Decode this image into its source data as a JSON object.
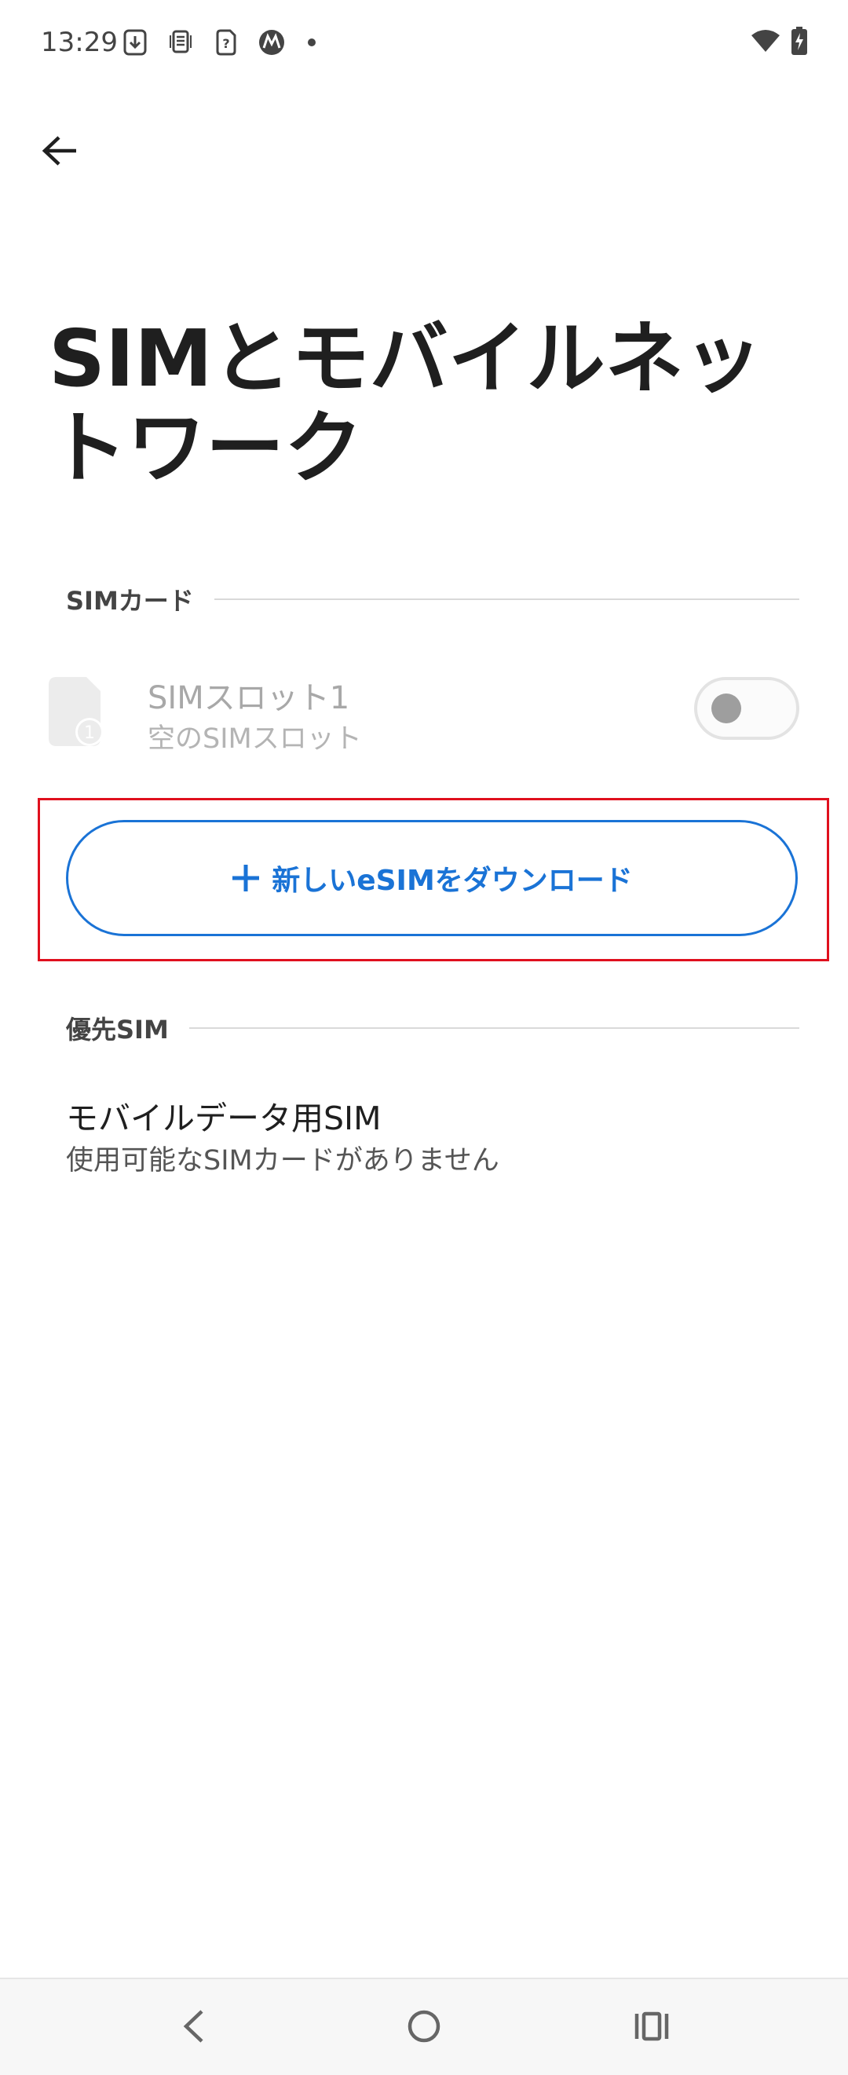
{
  "status_bar": {
    "time": "13:29",
    "left_icons": [
      "download-box-icon",
      "sim-activity-icon",
      "sim-unknown-icon",
      "motorola-logo-icon"
    ],
    "right_icons": [
      "wifi-icon",
      "battery-charging-icon"
    ]
  },
  "header": {
    "back_icon": "arrow-left-icon",
    "title": "SIMとモバイルネットワーク"
  },
  "sim_cards_section": {
    "header": "SIMカード",
    "slot": {
      "icon": "sim-card-icon",
      "badge": "1",
      "title": "SIMスロット1",
      "subtitle": "空のSIMスロット",
      "toggle_on": false
    }
  },
  "download_button": {
    "icon": "plus-icon",
    "label": "新しいeSIMをダウンロード",
    "accent_color": "#1a73d6",
    "highlight_color": "#e0101e"
  },
  "preferred_sim_section": {
    "header": "優先SIM",
    "item": {
      "title": "モバイルデータ用SIM",
      "subtitle": "使用可能なSIMカードがありません"
    }
  },
  "nav_bar": {
    "buttons": [
      "nav-back-icon",
      "nav-home-icon",
      "nav-recents-icon"
    ]
  }
}
